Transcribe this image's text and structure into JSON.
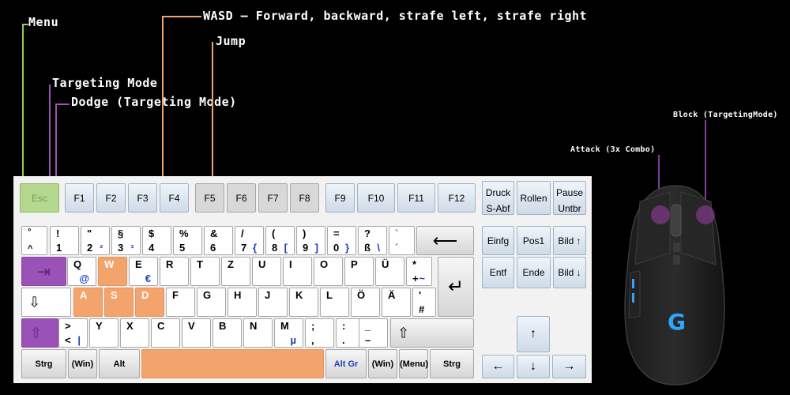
{
  "annotations": {
    "menu": "Menu",
    "wasd": "WASD – Forward, backward, strafe left, strafe right",
    "jump": "Jump",
    "targeting": "Targeting Mode",
    "dodge": "Dodge (Targeting Mode)",
    "block": "Block (TargetingMode)",
    "attack": "Attack (3x Combo)"
  },
  "colors": {
    "menu": "#8ed14c",
    "wasd": "#f3a36c",
    "targeting": "#9b52b8",
    "mouse_annot": "#7d3f9a"
  },
  "keyboard": {
    "fkeys": [
      "Esc",
      "F1",
      "F2",
      "F3",
      "F4",
      "F5",
      "F6",
      "F7",
      "F8",
      "F9",
      "F10",
      "F11",
      "F12"
    ],
    "sys": [
      [
        "Druck",
        "S-Abf"
      ],
      [
        "Rollen"
      ],
      [
        "Pause",
        "Untbr"
      ]
    ],
    "nav_top": [
      "Einfg",
      "Pos1",
      "Bild ↑"
    ],
    "nav_bottom": [
      "Entf",
      "Ende",
      "Bild ↓"
    ],
    "row1": [
      {
        "t": "°",
        "b": "^"
      },
      {
        "t": "!",
        "b": "1"
      },
      {
        "t": "\"",
        "b": "2",
        "r": "²"
      },
      {
        "t": "§",
        "b": "3",
        "r": "³"
      },
      {
        "t": "$",
        "b": "4"
      },
      {
        "t": "%",
        "b": "5"
      },
      {
        "t": "&",
        "b": "6"
      },
      {
        "t": "/",
        "b": "7",
        "r": "{"
      },
      {
        "t": "(",
        "b": "8",
        "r": "["
      },
      {
        "t": ")",
        "b": "9",
        "r": "]"
      },
      {
        "t": "=",
        "b": "0",
        "r": "}"
      },
      {
        "t": "?",
        "b": "ß",
        "r": "\\"
      },
      {
        "t": "`",
        "b": "´"
      }
    ],
    "backspace": "⟵",
    "tab": "⇥",
    "row2": [
      {
        "t": "Q",
        "r": "@"
      },
      {
        "t": "W"
      },
      {
        "t": "E",
        "r": "€"
      },
      {
        "t": "R"
      },
      {
        "t": "T"
      },
      {
        "t": "Z"
      },
      {
        "t": "U"
      },
      {
        "t": "I"
      },
      {
        "t": "O"
      },
      {
        "t": "P"
      },
      {
        "t": "Ü"
      },
      {
        "t": "*",
        "b": "+",
        "r": "~"
      }
    ],
    "enter": "↵",
    "caps": "⇩",
    "row3": [
      {
        "t": "A"
      },
      {
        "t": "S"
      },
      {
        "t": "D"
      },
      {
        "t": "F"
      },
      {
        "t": "G"
      },
      {
        "t": "H"
      },
      {
        "t": "J"
      },
      {
        "t": "K"
      },
      {
        "t": "L"
      },
      {
        "t": "Ö"
      },
      {
        "t": "Ä"
      },
      {
        "t": "'",
        "b": "#"
      }
    ],
    "lshift": "⇧",
    "row4": [
      {
        "t": ">",
        "b": "<",
        "r": "|"
      },
      {
        "t": "Y"
      },
      {
        "t": "X"
      },
      {
        "t": "C"
      },
      {
        "t": "V"
      },
      {
        "t": "B"
      },
      {
        "t": "N"
      },
      {
        "t": "M",
        "r": "µ"
      },
      {
        "t": ";",
        "b": ","
      },
      {
        "t": ":",
        "b": "."
      },
      {
        "t": "_",
        "b": "–"
      }
    ],
    "rshift": "⇧",
    "row5": [
      "Strg",
      "(Win)",
      "Alt",
      "",
      "Alt Gr",
      "(Win)",
      "(Menu)",
      "Strg"
    ],
    "arrows": {
      "up": "↑",
      "left": "←",
      "down": "↓",
      "right": "→"
    }
  }
}
